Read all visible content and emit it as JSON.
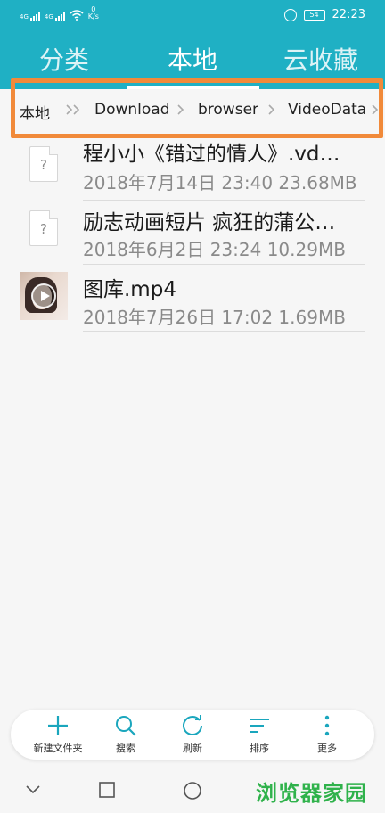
{
  "status_bar": {
    "signal_1": "4G",
    "signal_2": "4G",
    "net_speed_value": "0",
    "net_speed_unit": "K/s",
    "battery": "54",
    "time": "22:23"
  },
  "tabs": [
    {
      "label": "分类"
    },
    {
      "label": "本地"
    },
    {
      "label": "云收藏"
    }
  ],
  "breadcrumb": [
    "本地",
    "Download",
    "browser",
    "VideoData"
  ],
  "files": [
    {
      "name": "程小小《错过的情人》.vd…",
      "meta": "2018年7月14日 23:40 23.68MB",
      "icon": "unknown-file-icon",
      "icon_text": "?"
    },
    {
      "name": "励志动画短片 疯狂的蒲公…",
      "meta": "2018年6月2日 23:24 10.29MB",
      "icon": "unknown-file-icon",
      "icon_text": "?"
    },
    {
      "name": "图库.mp4",
      "meta": "2018年7月26日 17:02 1.69MB",
      "icon": "video-thumbnail"
    }
  ],
  "toolbar": [
    {
      "label": "新建文件夹",
      "icon": "plus-icon"
    },
    {
      "label": "搜索",
      "icon": "search-icon"
    },
    {
      "label": "刷新",
      "icon": "refresh-icon"
    },
    {
      "label": "排序",
      "icon": "sort-icon"
    },
    {
      "label": "更多",
      "icon": "more-icon"
    }
  ],
  "watermark": "浏览器家园",
  "colors": {
    "accent": "#1fb0c4",
    "highlight": "#f18a3a",
    "watermark": "#2fb24b"
  }
}
